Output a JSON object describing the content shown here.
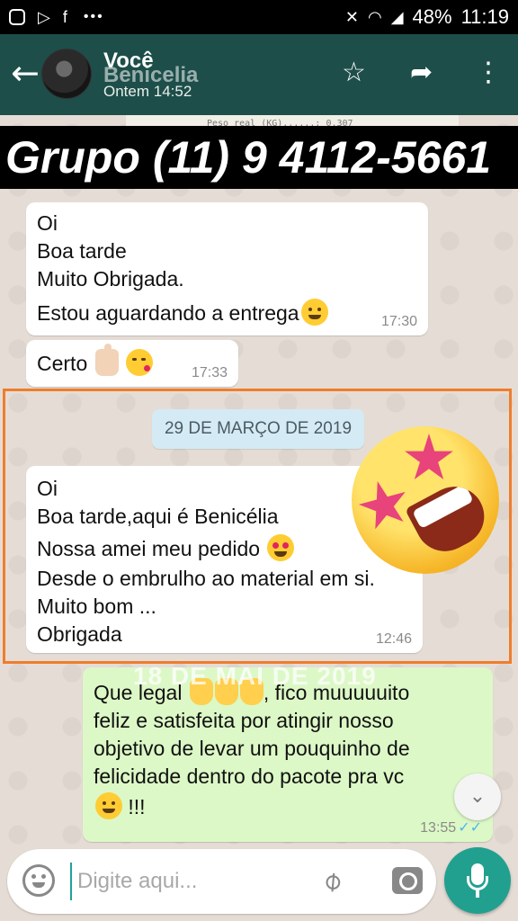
{
  "status_bar": {
    "battery": "48%",
    "time": "11:19"
  },
  "header": {
    "contact_name": "Você",
    "contact_sub": "Benicelia",
    "last_seen": "Ontem 14:52"
  },
  "banner": {
    "text": "Grupo (11) 9 4112-5661"
  },
  "receipt_strip": "Peso real (KG)......:   0,307",
  "messages": [
    {
      "direction": "in",
      "lines": [
        "Oi",
        "Boa tarde",
        "Muito Obrigada.",
        "Estou aguardando a entrega"
      ],
      "time": "17:30"
    },
    {
      "direction": "in",
      "lines": [
        "Certo"
      ],
      "time": "17:33"
    },
    {
      "direction": "in",
      "lines": [
        "Oi",
        "Boa tarde,aqui é Benicélia",
        "Nossa amei meu pedido",
        "Desde o embrulho ao material em si.",
        "Muito bom ...",
        "Obrigada"
      ],
      "time": "12:46"
    },
    {
      "direction": "out",
      "lines": [
        "Que legal",
        ", fico muuuuuito",
        "feliz e satisfeita por atingir nosso",
        "objetivo de levar um pouquinho de",
        "felicidade dentro do pacote pra vc",
        "!!!"
      ],
      "time": "13:55"
    }
  ],
  "date_separator": "29 DE MARÇO DE 2019",
  "overlay_date": "18 DE MAI DE 2019",
  "input": {
    "placeholder": "Digite aqui..."
  },
  "icons": {
    "back": "arrow-left-icon",
    "star": "star-icon",
    "forward": "forward-icon",
    "more": "more-vert-icon",
    "emoji": "emoji-icon",
    "attach": "paperclip-icon",
    "camera": "camera-icon",
    "mic": "mic-icon"
  },
  "colors": {
    "app_bar": "#1d4e4a",
    "chat_bg": "#e5ddd5",
    "bubble_out": "#dcf8c6",
    "accent": "#21a090",
    "highlight": "#ef7d2d",
    "date_pill": "#d4eaf4"
  }
}
